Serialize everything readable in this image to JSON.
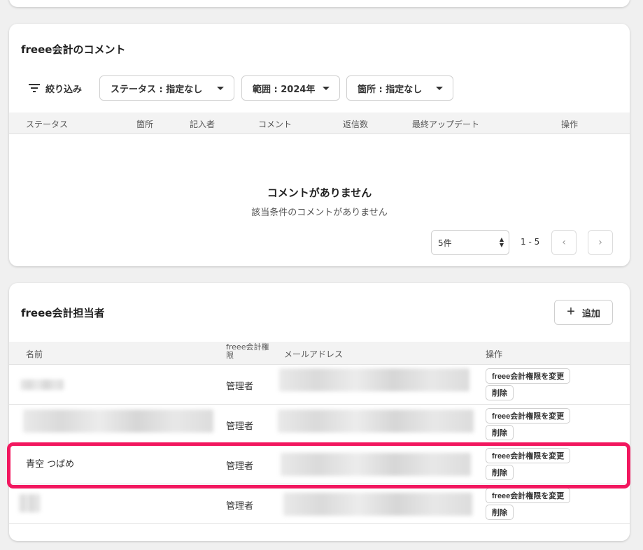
{
  "comments_section": {
    "title": "freee会計のコメント",
    "filter_label": "絞り込み",
    "filters": {
      "status": "ステータス : 指定なし",
      "range": "範囲 : 2024年",
      "location": "箇所 : 指定なし"
    },
    "columns": [
      "ステータス",
      "箇所",
      "記入者",
      "コメント",
      "返信数",
      "最終アップデート",
      "操作"
    ],
    "empty_title": "コメントがありません",
    "empty_subtitle": "該当条件のコメントがありません",
    "pagination": {
      "per_page": "5件",
      "range": "1 - 5"
    }
  },
  "members_section": {
    "title": "freee会計担当者",
    "add_label": "追加",
    "columns": {
      "name": "名前",
      "permission": "freee会計権限",
      "email": "メールアドレス",
      "actions": "操作"
    },
    "rows": [
      {
        "name": "",
        "role": "管理者",
        "change_label": "freee会計権限を変更",
        "delete_label": "削除"
      },
      {
        "name": "",
        "role": "管理者",
        "change_label": "freee会計権限を変更",
        "delete_label": "削除"
      },
      {
        "name": "青空 つばめ",
        "role": "管理者",
        "change_label": "freee会計権限を変更",
        "delete_label": "削除"
      },
      {
        "name": "",
        "role": "管理者",
        "change_label": "freee会計権限を変更",
        "delete_label": "削除"
      }
    ]
  },
  "colors": {
    "highlight": "#f2175f",
    "header_bg": "#f3f3f3",
    "page_bg": "#f0f0f0"
  }
}
